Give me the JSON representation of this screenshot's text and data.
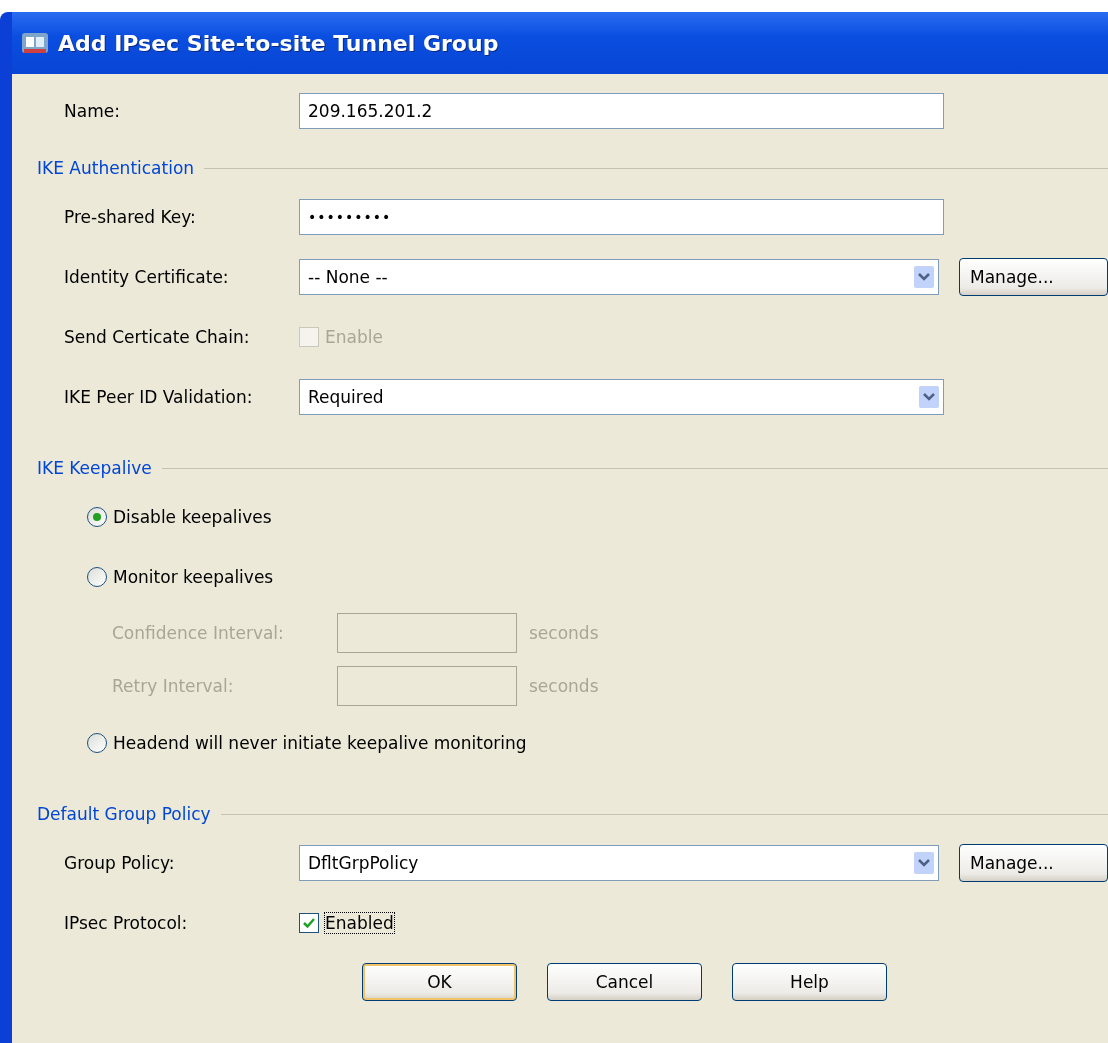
{
  "window": {
    "title": "Add IPsec Site-to-site Tunnel Group"
  },
  "name_field": {
    "label": "Name:",
    "value": "209.165.201.2"
  },
  "ike_authentication": {
    "title": "IKE Authentication",
    "pre_shared_key": {
      "label": "Pre-shared Key:",
      "value": "•••••••••"
    },
    "identity_certificate": {
      "label": "Identity Certificate:",
      "value": "-- None --",
      "button": "Manage..."
    },
    "send_certificate_chain": {
      "label": "Send Certicate Chain:",
      "checkbox_label": "Enable",
      "checked": false,
      "disabled": true
    },
    "peer_id_validation": {
      "label": "IKE Peer ID Validation:",
      "value": "Required"
    }
  },
  "ike_keepalive": {
    "title": "IKE Keepalive",
    "options": [
      {
        "kind": "radio",
        "label": "Disable keepalives",
        "selected": true
      },
      {
        "kind": "radio",
        "label": "Monitor keepalives",
        "selected": false
      },
      {
        "kind": "interval",
        "label": "Confidence Interval:",
        "unit": "seconds",
        "disabled": true
      },
      {
        "kind": "interval",
        "label": "Retry Interval:",
        "unit": "seconds",
        "disabled": true
      },
      {
        "kind": "radio",
        "label": "Headend will never initiate keepalive monitoring",
        "selected": false
      }
    ]
  },
  "default_group_policy": {
    "title": "Default Group Policy",
    "group_policy": {
      "label": "Group Policy:",
      "value": "DfltGrpPolicy",
      "button": "Manage..."
    },
    "ipsec_protocol": {
      "label": "IPsec Protocol:",
      "checkbox_label": "Enabled",
      "checked": true
    }
  },
  "buttons": [
    {
      "label": "OK",
      "default": true
    },
    {
      "label": "Cancel",
      "default": false
    },
    {
      "label": "Help",
      "default": false
    }
  ]
}
